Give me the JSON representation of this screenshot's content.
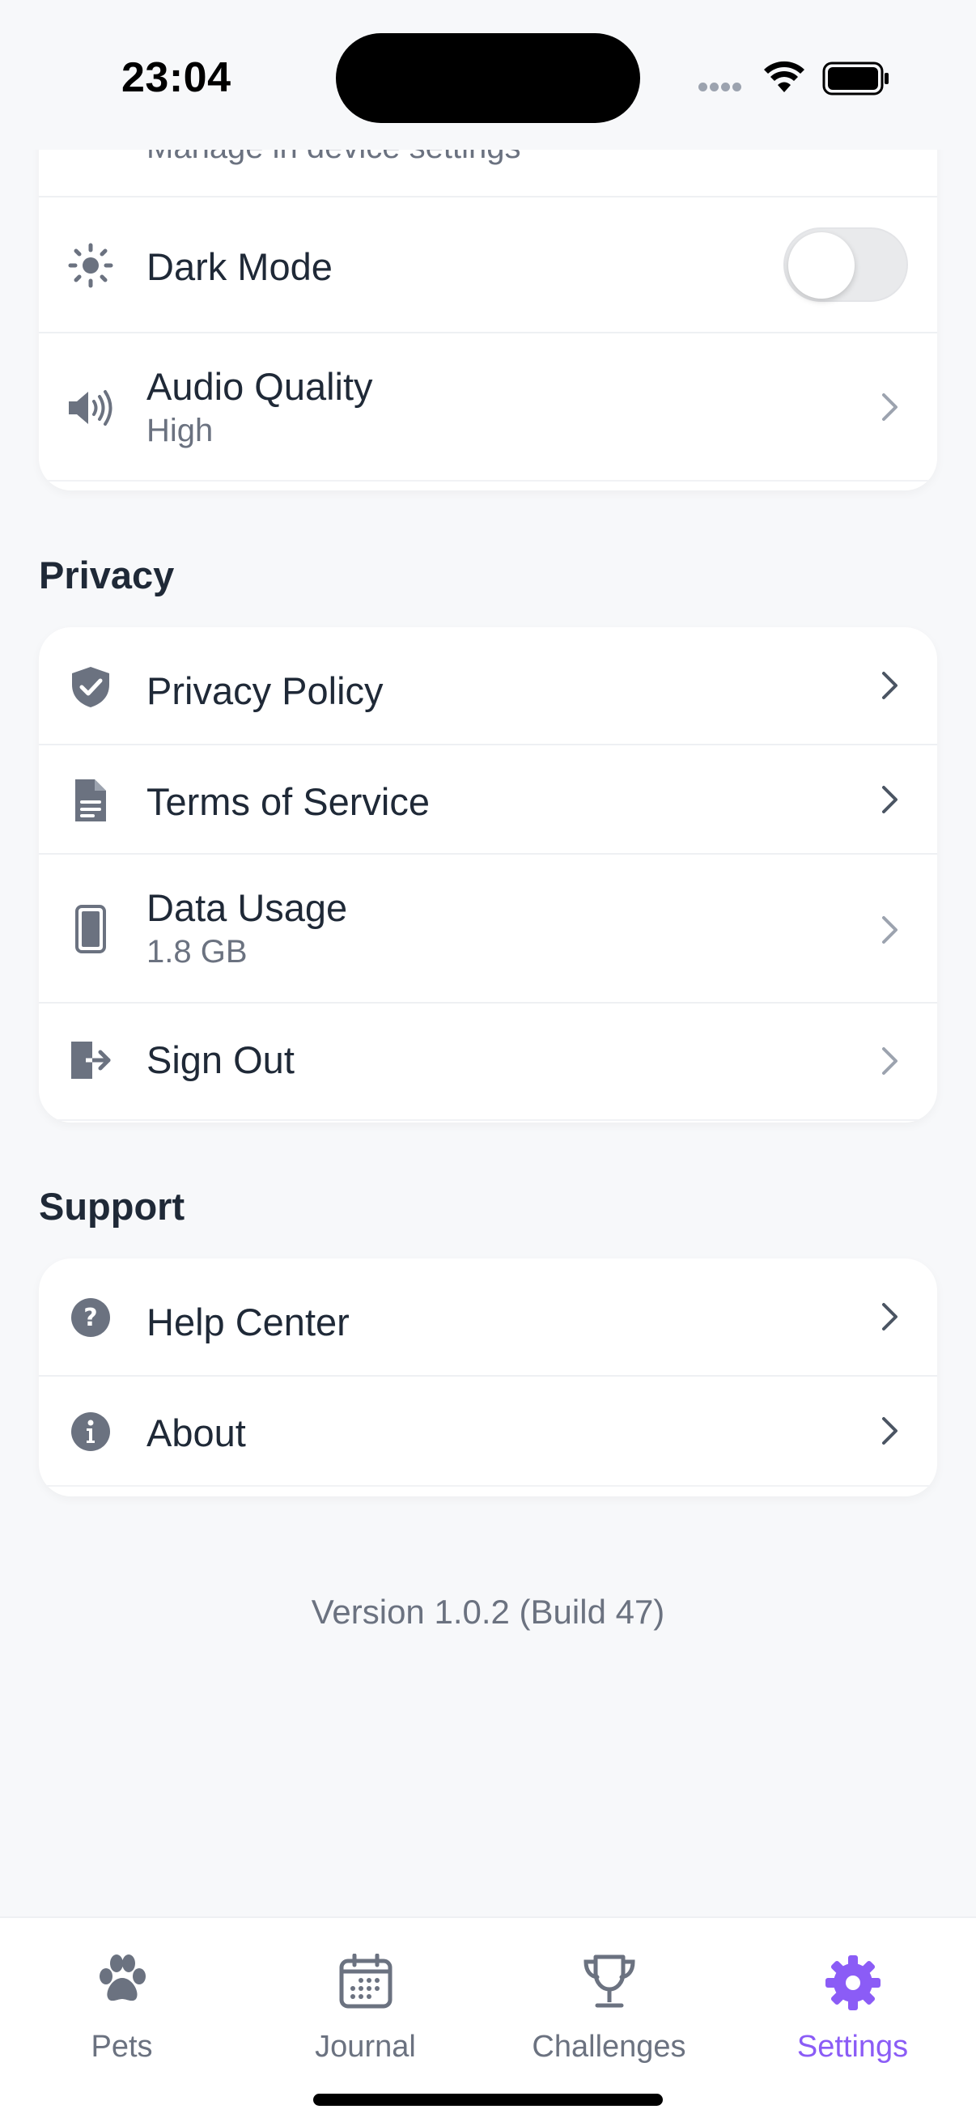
{
  "status_bar": {
    "time": "23:04"
  },
  "top_card": {
    "partial_subtitle": "Manage in device settings",
    "dark_mode": {
      "label": "Dark Mode",
      "enabled": false
    },
    "audio_quality": {
      "label": "Audio Quality",
      "value": "High"
    }
  },
  "privacy": {
    "title": "Privacy",
    "items": [
      {
        "label": "Privacy Policy",
        "icon": "shield-check-icon"
      },
      {
        "label": "Terms of Service",
        "icon": "document-icon"
      },
      {
        "label": "Data Usage",
        "value": "1.8 GB",
        "icon": "phone-icon"
      },
      {
        "label": "Sign Out",
        "icon": "sign-out-icon"
      }
    ]
  },
  "support": {
    "title": "Support",
    "items": [
      {
        "label": "Help Center",
        "icon": "question-circle-icon"
      },
      {
        "label": "About",
        "icon": "info-circle-icon"
      }
    ]
  },
  "version": "Version 1.0.2 (Build 47)",
  "tabs": [
    {
      "label": "Pets",
      "icon": "paw-icon",
      "active": false
    },
    {
      "label": "Journal",
      "icon": "calendar-icon",
      "active": false
    },
    {
      "label": "Challenges",
      "icon": "trophy-icon",
      "active": false
    },
    {
      "label": "Settings",
      "icon": "gear-icon",
      "active": true
    }
  ],
  "colors": {
    "accent": "#8b5cf6",
    "icon_gray": "#6b7280",
    "background": "#f7f8fa"
  }
}
